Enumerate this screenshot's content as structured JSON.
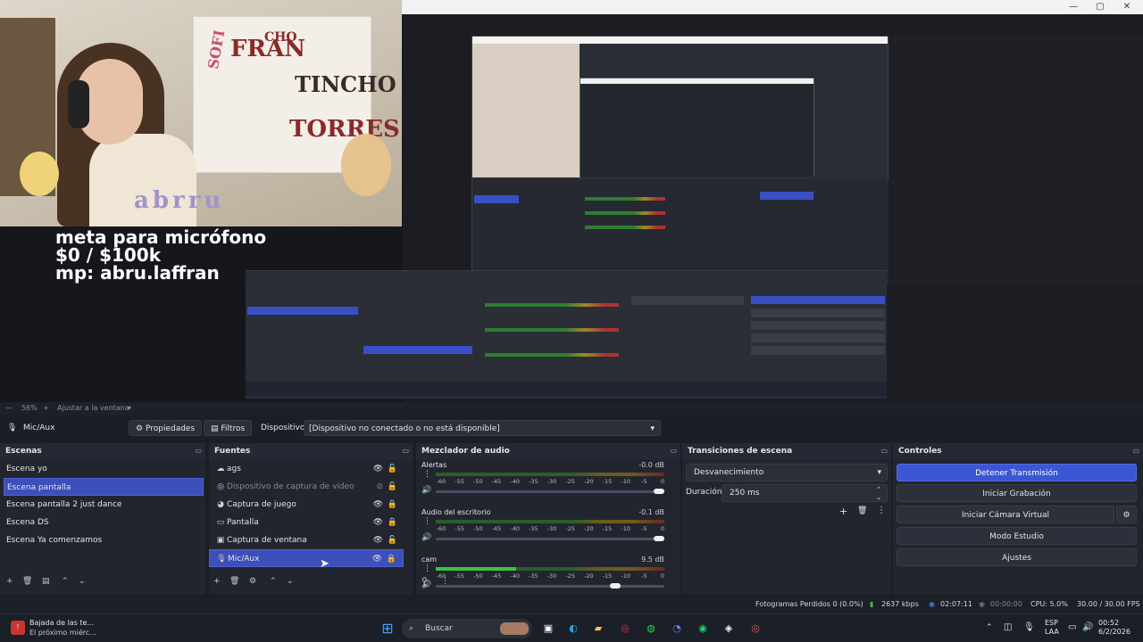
{
  "window_controls": {
    "minimize": "—",
    "maximize": "▢",
    "close": "✕"
  },
  "stream_overlay": {
    "line1": "meta para micrófono",
    "line2": "$0 / $100k",
    "line3": "mp: abru.laffran",
    "webcam_logo": "abrru",
    "poster_words": [
      "FRAN",
      "TINCHO",
      "TORRES",
      "SOFI",
      "CHO"
    ]
  },
  "preview_footer": {
    "zoom": "56%",
    "add": "+",
    "fit_label": "Ajustar a la ventana"
  },
  "source_toolbar": {
    "source_name": "Mic/Aux",
    "properties": "Propiedades",
    "filters": "Filtros",
    "device_label": "Dispositivo",
    "device_value": "[Dispositivo no conectado o no está disponible]"
  },
  "scenes": {
    "title": "Escenas",
    "items": [
      {
        "label": "Escena yo"
      },
      {
        "label": "Escena pantalla"
      },
      {
        "label": "Escena pantalla 2 just dance"
      },
      {
        "label": "Escena DS"
      },
      {
        "label": "Escena Ya comenzamos"
      }
    ],
    "selected_index": 1
  },
  "sources": {
    "title": "Fuentes",
    "items": [
      {
        "label": "ags",
        "icon": "image-icon"
      },
      {
        "label": "Dispositivo de captura de vídeo",
        "icon": "camera-icon",
        "hidden": true
      },
      {
        "label": "Captura de juego",
        "icon": "gamepad-icon"
      },
      {
        "label": "Pantalla",
        "icon": "monitor-icon"
      },
      {
        "label": "Captura de ventana",
        "icon": "window-icon"
      },
      {
        "label": "Mic/Aux",
        "icon": "mic-icon"
      }
    ],
    "selected_index": 5
  },
  "mixer": {
    "title": "Mezclador de audio",
    "scale": [
      "-60",
      "-55",
      "-50",
      "-45",
      "-40",
      "-35",
      "-30",
      "-25",
      "-20",
      "-15",
      "-10",
      "-5",
      "0"
    ],
    "channels": [
      {
        "name": "Alertas",
        "db": "-0.0 dB",
        "level": 0.0,
        "volume": 1.0
      },
      {
        "name": "Audio del escritorio",
        "db": "-0.1 dB",
        "level": 0.0,
        "volume": 1.0
      },
      {
        "name": "cam",
        "db": "9.5 dB",
        "level": 0.35,
        "volume": 0.8
      }
    ]
  },
  "transitions": {
    "title": "Transiciones de escena",
    "selected": "Desvanecimiento",
    "duration_label": "Duración",
    "duration_value": "250 ms"
  },
  "controls": {
    "title": "Controles",
    "stop_stream": "Detener Transmisión",
    "start_recording": "Iniciar Grabación",
    "start_virtual_cam": "Iniciar Cámara Virtual",
    "studio_mode": "Modo Estudio",
    "settings": "Ajustes"
  },
  "statusbar": {
    "dropped_frames": "Fotogramas Perdidos 0 (0.0%)",
    "bitrate": "2637 kbps",
    "stream_time": "02:07:11",
    "rec_time": "00:00:00",
    "cpu": "CPU: 5.0%",
    "fps": "30.00 / 30.00 FPS"
  },
  "taskbar": {
    "notification_title": "Bajada de las te...",
    "notification_sub": "El próximo miérc...",
    "search_placeholder": "Buscar",
    "lang_line1": "ESP",
    "lang_line2": "LAA",
    "time": "00:52",
    "date": "6/2/2026"
  },
  "colors": {
    "accent": "#3c55d3",
    "panel": "#23252e",
    "background": "#1c1e25"
  }
}
